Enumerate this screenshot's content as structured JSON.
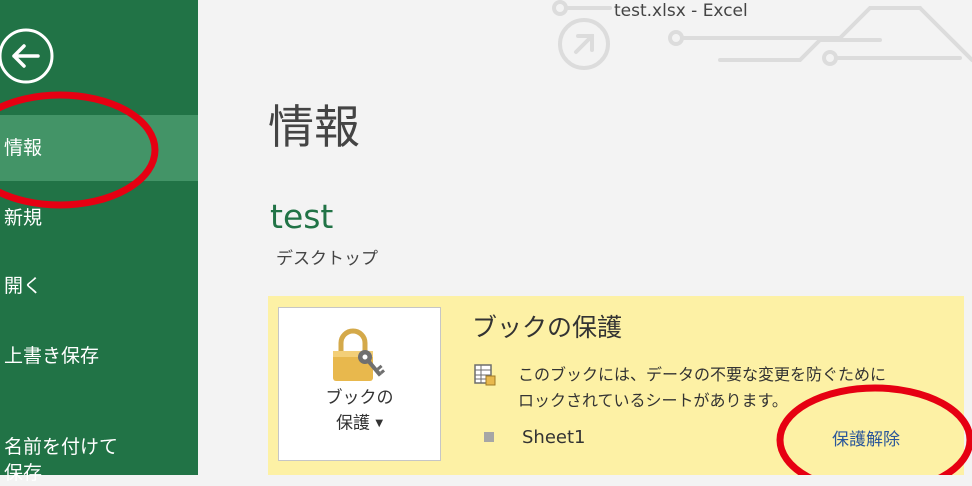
{
  "window": {
    "title": "test.xlsx - Excel"
  },
  "sidebar": {
    "items": [
      {
        "label": "情報"
      },
      {
        "label": "新規"
      },
      {
        "label": "開く"
      },
      {
        "label": "上書き保存"
      },
      {
        "label": "名前を付けて\n保存"
      }
    ]
  },
  "main": {
    "title": "情報",
    "file_name": "test",
    "file_location": "デスクトップ",
    "protect": {
      "button_label_line1": "ブックの",
      "button_label_line2": "保護",
      "heading": "ブックの保護",
      "description": "このブックには、データの不要な変更を防ぐために\nロックされているシートがあります。",
      "sheets": [
        {
          "name": "Sheet1",
          "action": "保護解除"
        }
      ]
    }
  },
  "colors": {
    "sidebar": "#217346",
    "sidebar_active": "#439467",
    "panel": "#fdf1a5",
    "link": "#2b579a",
    "annotation": "#e60012"
  },
  "icons": {
    "back": "back-arrow-icon",
    "lock": "lock-key-icon",
    "sheet": "protected-sheet-icon"
  }
}
